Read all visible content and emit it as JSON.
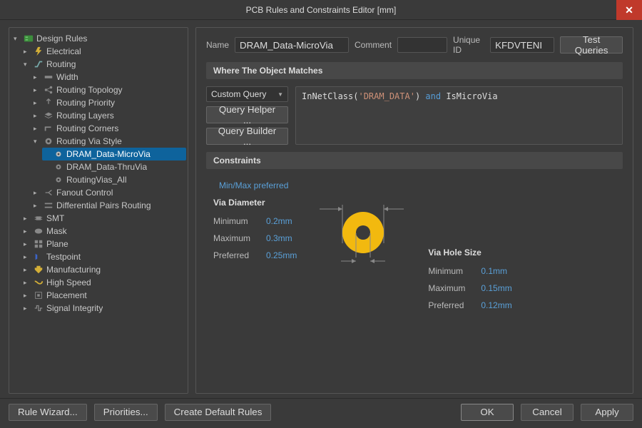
{
  "window": {
    "title": "PCB Rules and Constraints Editor [mm]"
  },
  "tree": {
    "root": "Design Rules",
    "electrical": "Electrical",
    "routing": "Routing",
    "width": "Width",
    "routing_topology": "Routing Topology",
    "routing_priority": "Routing Priority",
    "routing_layers": "Routing Layers",
    "routing_corners": "Routing Corners",
    "routing_via_style": "Routing Via Style",
    "rule_microvia": "DRAM_Data-MicroVia",
    "rule_thruvia": "DRAM_Data-ThruVia",
    "rule_all": "RoutingVias_All",
    "fanout": "Fanout Control",
    "diffpairs": "Differential Pairs Routing",
    "smt": "SMT",
    "mask": "Mask",
    "plane": "Plane",
    "testpoint": "Testpoint",
    "mfg": "Manufacturing",
    "highspeed": "High Speed",
    "placement": "Placement",
    "si": "Signal Integrity"
  },
  "form": {
    "name_label": "Name",
    "name_value": "DRAM_Data-MicroVia",
    "comment_label": "Comment",
    "comment_value": "",
    "uid_label": "Unique ID",
    "uid_value": "KFDVTENI",
    "test_queries": "Test Queries"
  },
  "match": {
    "header": "Where The Object Matches",
    "scope": "Custom Query",
    "helper": "Query Helper ...",
    "builder": "Query Builder ...",
    "query_prefix": "InNetClass(",
    "query_string": "'DRAM_DATA'",
    "query_mid": ") ",
    "query_kw": "and",
    "query_suffix": " IsMicroVia"
  },
  "constraints": {
    "header": "Constraints",
    "minmax": "Min/Max preferred",
    "diameter_title": "Via Diameter",
    "hole_title": "Via Hole Size",
    "minimum": "Minimum",
    "maximum": "Maximum",
    "preferred": "Preferred",
    "dia_min": "0.2mm",
    "dia_max": "0.3mm",
    "dia_pref": "0.25mm",
    "hole_min": "0.1mm",
    "hole_max": "0.15mm",
    "hole_pref": "0.12mm"
  },
  "footer": {
    "wizard": "Rule Wizard...",
    "priorities": "Priorities...",
    "defaults": "Create Default Rules",
    "ok": "OK",
    "cancel": "Cancel",
    "apply": "Apply"
  },
  "colors": {
    "via": "#f2b90f",
    "accent": "#0e639c"
  }
}
